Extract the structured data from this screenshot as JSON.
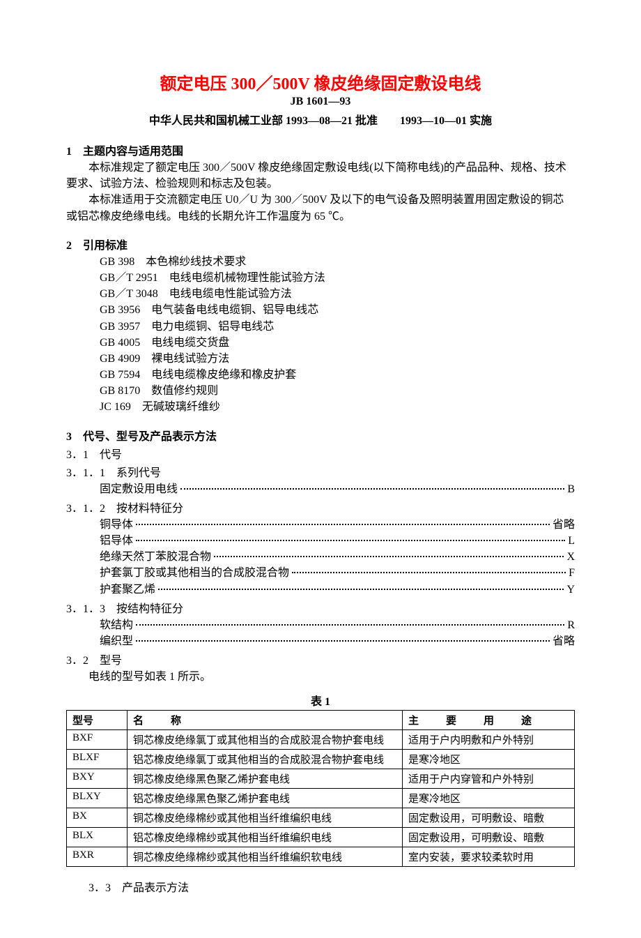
{
  "title": "额定电压 300／500V 橡皮绝缘固定敷设电线",
  "std_no": "JB 1601—93",
  "approval": "中华人民共和国机械工业部 1993—08—21 批准  1993—10—01 实施",
  "sec1": {
    "heading": "1　主题内容与适用范围",
    "p1": "本标准规定了额定电压 300／500V 橡皮绝缘固定敷设电线(以下简称电线)的产品品种、规格、技术要求、试验方法、检验规则和标志及包装。",
    "p2": "本标准适用于交流额定电压 U0／U 为 300／500V 及以下的电气设备及照明装置用固定敷设的铜芯或铝芯橡皮绝缘电线。电线的长期允许工作温度为 65 ℃。"
  },
  "sec2": {
    "heading": "2　引用标准",
    "items": [
      "GB 398　本色棉纱线技术要求",
      "GB／T 2951　电线电缆机械物理性能试验方法",
      "GB／T 3048　电线电缆电性能试验方法",
      "GB 3956　电气装备电线电缆铜、铝导电线芯",
      "GB 3957　电力电缆铜、铝导电线芯",
      "GB 4005　电线电缆交货盘",
      "GB 4909　裸电线试验方法",
      "GB 7594　电线电缆橡皮绝缘和橡皮护套",
      "GB 8170　数值修约规则",
      "JC 169　无碱玻璃纤维纱"
    ]
  },
  "sec3": {
    "heading": "3　代号、型号及产品表示方法",
    "s31": "3．1　代号",
    "s311": "3．1．1　系列代号",
    "s311_items": [
      {
        "label": "固定敷设用电线",
        "code": "B"
      }
    ],
    "s312": "3．1．2　按材料特征分",
    "s312_items": [
      {
        "label": "铜导体",
        "code": "省略"
      },
      {
        "label": "铝导体",
        "code": "L"
      },
      {
        "label": "绝缘天然丁苯胶混合物",
        "code": "X"
      },
      {
        "label": "护套氯丁胶或其他相当的合成胶混合物",
        "code": "F"
      },
      {
        "label": "护套聚乙烯",
        "code": "Y"
      }
    ],
    "s313": "3．1．3　按结构特征分",
    "s313_items": [
      {
        "label": "软结构",
        "code": "R"
      },
      {
        "label": "编织型",
        "code": "省略"
      }
    ],
    "s32": "3．2　型号",
    "s32_p": "电线的型号如表 1 所示。"
  },
  "table1": {
    "caption": "表 1",
    "headers": {
      "model": "型号",
      "name": "名　称",
      "use": "主　要　用　途"
    },
    "rows": [
      {
        "model": "BXF",
        "name": "铜芯橡皮绝缘氯丁或其他相当的合成胶混合物护套电线",
        "use": "适用于户内明敷和户外特别"
      },
      {
        "model": "BLXF",
        "name": "铝芯橡皮绝缘氯丁或其他相当的合成胶混合物护套电线",
        "use": "是寒冷地区"
      },
      {
        "model": "BXY",
        "name": "铜芯橡皮绝缘黑色聚乙烯护套电线",
        "use": "适用于户内穿管和户外特别"
      },
      {
        "model": "BLXY",
        "name": "铝芯橡皮绝缘黑色聚乙烯护套电线",
        "use": "是寒冷地区"
      },
      {
        "model": "BX",
        "name": "铜芯橡皮绝缘棉纱或其他相当纤维编织电线",
        "use": "固定敷设用，可明敷设、暗敷"
      },
      {
        "model": "BLX",
        "name": "铝芯橡皮绝缘棉纱或其他相当纤维编织电线",
        "use": "固定敷设用，可明敷设、暗敷"
      },
      {
        "model": "BXR",
        "name": "铜芯橡皮绝缘棉纱或其他相当纤维编织软电线",
        "use": "室内安装，要求较柔软时用"
      }
    ]
  },
  "s33": "3．3　产品表示方法"
}
